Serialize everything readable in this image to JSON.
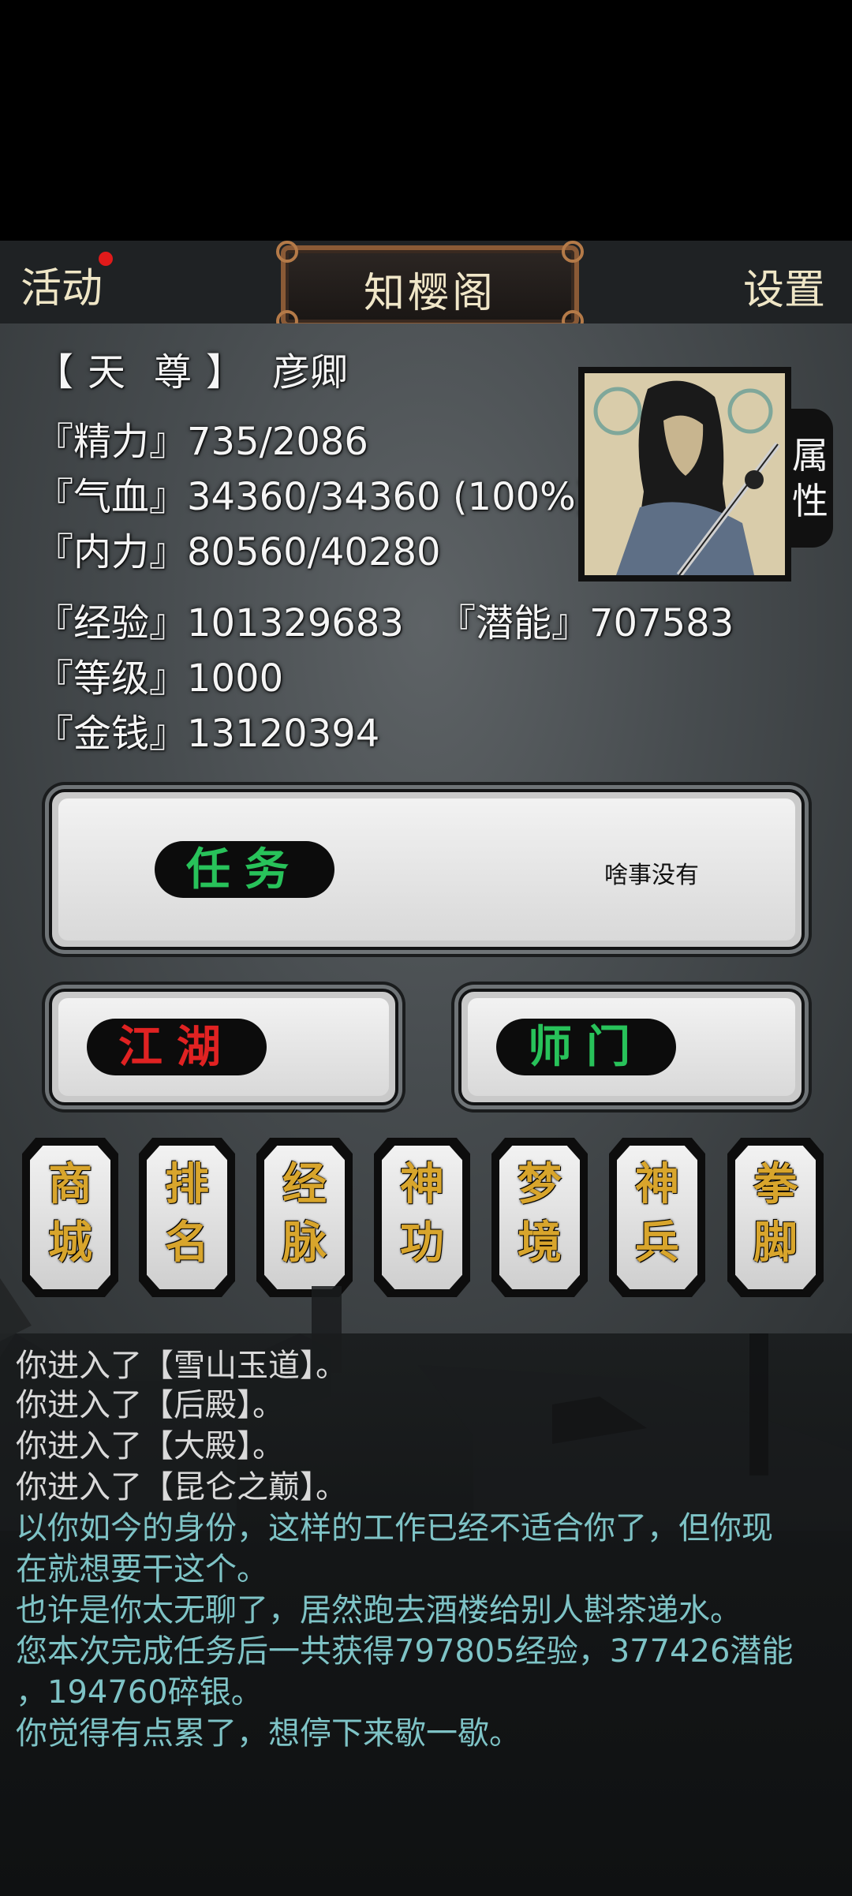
{
  "header": {
    "activity_label": "活动",
    "title": "知樱阁",
    "settings_label": "设置"
  },
  "profile": {
    "rank": [
      "【",
      "天",
      "尊",
      "】"
    ],
    "name": "彦卿",
    "stats": {
      "energy": "『精力』735/2086",
      "hp": "『气血』34360/34360 (100%)",
      "inner": "『内力』80560/40280",
      "exp": "『经验』101329683",
      "potential": "『潜能』707583",
      "level": "『等级』1000",
      "money": "『金钱』13120394"
    },
    "attr_tab": [
      "属",
      "性"
    ]
  },
  "task": {
    "label": "任务",
    "status": "啥事没有"
  },
  "jianghu_label": "江湖",
  "shimen_label": "师门",
  "tiles": [
    [
      "商",
      "城"
    ],
    [
      "排",
      "名"
    ],
    [
      "经",
      "脉"
    ],
    [
      "神",
      "功"
    ],
    [
      "梦",
      "境"
    ],
    [
      "神",
      "兵"
    ],
    [
      "拳",
      "脚"
    ]
  ],
  "log": [
    {
      "text": "你进入了【雪山玉道】。",
      "color": "grey"
    },
    {
      "text": "你进入了【后殿】。",
      "color": "grey"
    },
    {
      "text": "你进入了【大殿】。",
      "color": "grey"
    },
    {
      "text": "你进入了【昆仑之巅】。",
      "color": "grey"
    },
    {
      "text": "以你如今的身份，这样的工作已经不适合你了，但你现",
      "color": "teal"
    },
    {
      "text": "在就想要干这个。",
      "color": "teal"
    },
    {
      "text": "也许是你太无聊了，居然跑去酒楼给别人斟茶递水。",
      "color": "teal"
    },
    {
      "text": "您本次完成任务后一共获得797805经验，377426潜能",
      "color": "teal"
    },
    {
      "text": "，194760碎银。",
      "color": "teal"
    },
    {
      "text": "你觉得有点累了，想停下来歇一歇。",
      "color": "teal"
    }
  ],
  "colors": {
    "accent_green": "#28c25a",
    "accent_red": "#e02222",
    "tile_gold": "#d8a52c",
    "log_teal": "#7ec3c6"
  }
}
